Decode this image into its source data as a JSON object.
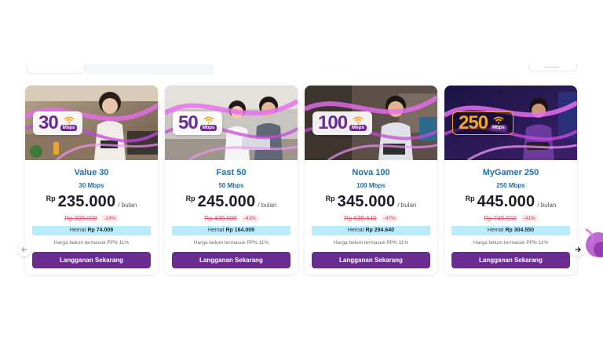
{
  "colors": {
    "brand_purple": "#6b2c91",
    "link_blue": "#1f6fa8",
    "old_price_red": "#e0566a",
    "savings_bg": "#b9ecfb"
  },
  "icons": {
    "prev": "arrow-left-icon",
    "next": "arrow-right-icon",
    "badge": "wifi-icon"
  },
  "cards": [
    {
      "badge_number": "30",
      "badge_unit": "Mbps",
      "name": "Value 30",
      "speed": "30 Mbps",
      "currency": "Rp",
      "price": "235.000",
      "period": "/ bulan",
      "old_price": "Rp 309.009",
      "discount": "-24%",
      "savings_label": "Hemat",
      "savings_value": "Rp 74.009",
      "tax_note": "Harga belum termasuk PPN 11%",
      "cta": "Langganan Sekarang"
    },
    {
      "badge_number": "50",
      "badge_unit": "Mbps",
      "name": "Fast 50",
      "speed": "50 Mbps",
      "currency": "Rp",
      "price": "245.000",
      "period": "/ bulan",
      "old_price": "Rp 409.009",
      "discount": "-41%",
      "savings_label": "Hemat",
      "savings_value": "Rp 164.009",
      "tax_note": "Harga belum termasuk PPN 11%",
      "cta": "Langganan Sekarang"
    },
    {
      "badge_number": "100",
      "badge_unit": "Mbps",
      "name": "Nova 100",
      "speed": "100 Mbps",
      "currency": "Rp",
      "price": "345.000",
      "period": "/ bulan",
      "old_price": "Rp 639.640",
      "discount": "-47%",
      "savings_label": "Hemat",
      "savings_value": "Rp 294.640",
      "tax_note": "Harga belum termasuk PPN 11%",
      "cta": "Langganan Sekarang"
    },
    {
      "badge_number": "250",
      "badge_unit": "Mbps",
      "name": "MyGamer 250",
      "speed": "250 Mbps",
      "currency": "Rp",
      "price": "445.000",
      "period": "/ bulan",
      "old_price": "Rp 749.550",
      "discount": "-41%",
      "savings_label": "Hemat",
      "savings_value": "Rp 304.550",
      "tax_note": "Harga belum termasuk PPN 11%",
      "cta": "Langganan Sekarang"
    }
  ]
}
